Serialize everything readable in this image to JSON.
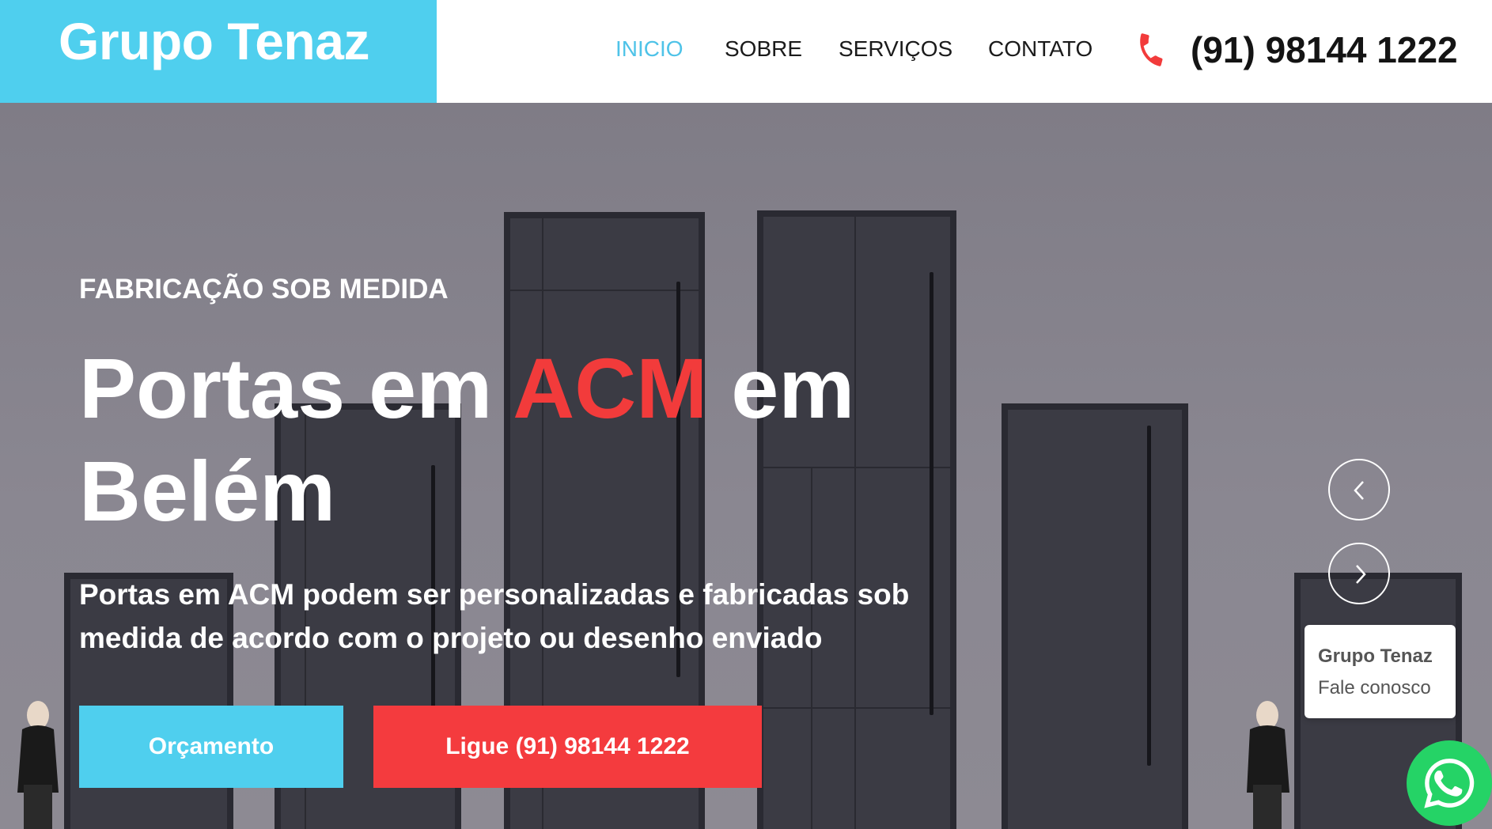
{
  "brand": {
    "name": "Grupo Tenaz",
    "color": "#4fcfee"
  },
  "nav": {
    "items": [
      {
        "label": "INICIO",
        "active": true
      },
      {
        "label": "SOBRE",
        "active": false
      },
      {
        "label": "SERVIÇOS",
        "active": false
      },
      {
        "label": "CONTATO",
        "active": false
      }
    ],
    "phone_icon": "phone-icon",
    "phone": "(91) 98144 1222"
  },
  "hero": {
    "kicker": "FABRICAÇÃO SOB MEDIDA",
    "headline_part1": "Portas em ",
    "headline_accent": "ACM",
    "headline_part2": " em Belém",
    "accent_color": "#f23b3b",
    "description": "Portas em ACM podem ser personalizadas e fabricadas sob medida de acordo com o projeto ou desenho enviado",
    "buttons": {
      "quote": "Orçamento",
      "call": "Ligue (91) 98144 1222"
    },
    "slider_prev_icon": "chevron-left-icon",
    "slider_next_icon": "chevron-right-icon"
  },
  "chat_widget": {
    "name": "Grupo Tenaz",
    "subtitle": "Fale conosco",
    "icon": "whatsapp-icon"
  }
}
